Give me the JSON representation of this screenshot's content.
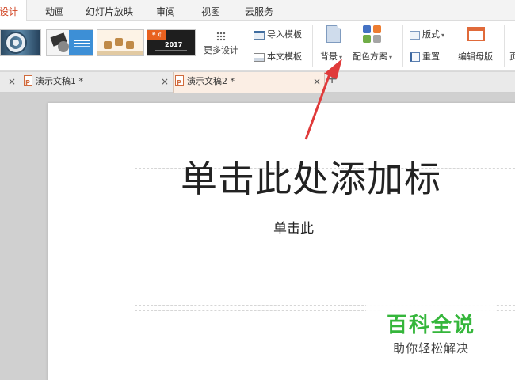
{
  "menu": {
    "tabs": [
      {
        "label": "设计",
        "active": true
      },
      {
        "label": "动画"
      },
      {
        "label": "幻灯片放映"
      },
      {
        "label": "审阅"
      },
      {
        "label": "视图"
      },
      {
        "label": "云服务"
      }
    ]
  },
  "ribbon": {
    "thumb4_badge": "¥ ¢",
    "thumb4_year": "2017",
    "more_designs": "更多设计",
    "import_template": "导入模板",
    "body_template": "本文模板",
    "background": "背景",
    "color_scheme": "配色方案",
    "layout": "版式",
    "reset": "重置",
    "edit_master": "编辑母版",
    "page_cut": "页",
    "caret": "▾",
    "palette_colors": [
      "#4472c4",
      "#ed7d31",
      "#70ad47",
      "#a5a5a5"
    ]
  },
  "doc_tabs": {
    "tabs": [
      {
        "label": "演示文稿1 *"
      },
      {
        "label": "演示文稿2 *",
        "active": true
      }
    ],
    "close": "×",
    "new_tab": "+"
  },
  "slide": {
    "title_placeholder": "单击此处添加标",
    "subtitle_placeholder": "单击此"
  },
  "watermark": {
    "brand": "百科全说",
    "tagline": "助你轻松解决"
  },
  "colors": {
    "accent": "#d24726",
    "arrow": "#e03a3a",
    "watermark_green": "#35b63b"
  }
}
